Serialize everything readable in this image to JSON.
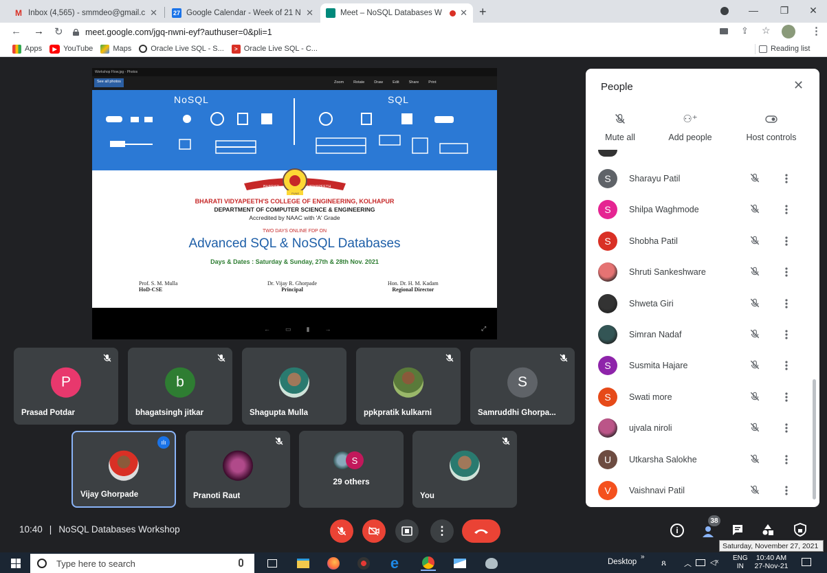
{
  "browser": {
    "tabs": [
      {
        "title": "Inbox (4,565) - smmdeo@gmail.c",
        "favicon": "gmail-icon"
      },
      {
        "title": "Google Calendar - Week of 21 N",
        "favicon": "calendar-icon",
        "favicon_text": "27"
      },
      {
        "title": "Meet – NoSQL Databases W",
        "favicon": "meet-icon",
        "active": true
      }
    ],
    "new_tab": "+",
    "url": "meet.google.com/jgq-nwni-eyf?authuser=0&pli=1",
    "bookmarks": [
      {
        "label": "Apps",
        "icon": "apps-grid-icon"
      },
      {
        "label": "YouTube",
        "icon": "youtube-icon"
      },
      {
        "label": "Maps",
        "icon": "maps-icon"
      },
      {
        "label": "Oracle Live SQL - S...",
        "icon": "oracle-icon"
      },
      {
        "label": "Oracle Live SQL - C...",
        "icon": "oracle-console-icon"
      }
    ],
    "reading_list": "Reading list"
  },
  "presentation": {
    "photos_title": "Workshop Flow.jpg - Photos",
    "see_all": "See all photos",
    "toolbar": [
      "Zoom",
      "Rotate",
      "Draw",
      "Edit",
      "Share",
      "Print"
    ],
    "slide": {
      "nosql": "NoSQL",
      "sql": "SQL",
      "college": "BHARATI VIDYAPEETH'S COLLEGE OF ENGINEERING, KOLHAPUR",
      "logo_left": "BHARATI",
      "logo_right": "VIDYAPEETH",
      "logo_bottom": "PUNE",
      "dept": "DEPARTMENT OF COMPUTER SCIENCE & ENGINEERING",
      "accred": "Accredited by NAAC with 'A' Grade",
      "fdp": "TWO DAYS ONLINE FDP ON",
      "title": "Advanced SQL & NoSQL Databases",
      "dates": "Days & Dates : Saturday & Sunday, 27th & 28th Nov. 2021",
      "people": [
        {
          "name": "Prof. S. M. Mulla",
          "role": "HoD-CSE"
        },
        {
          "name": "Dr. Vijay R. Ghorpade",
          "role": "Principal"
        },
        {
          "name": "Hon. Dr. H. M. Kadam",
          "role": "Regional Director"
        }
      ]
    }
  },
  "tiles": [
    {
      "name": "Prasad Potdar",
      "avatar_letter": "P",
      "color": "#e8386d"
    },
    {
      "name": "bhagatsingh jitkar",
      "avatar_letter": "b",
      "color": "#2e7d32"
    },
    {
      "name": "Shagupta Mulla",
      "avatar_letter": "",
      "color": "#7aa"
    },
    {
      "name": "ppkpratik kulkarni",
      "avatar_letter": "",
      "color": "#8a6"
    },
    {
      "name": "Samruddhi Ghorpa...",
      "avatar_letter": "S",
      "color": "#5f6368"
    },
    {
      "name": "Vijay Ghorpade",
      "avatar_letter": "",
      "color": "#aaa"
    },
    {
      "name": "Pranoti Raut",
      "avatar_letter": "",
      "color": "#603"
    },
    {
      "name": "29 others",
      "avatar_letter": "S",
      "color": "#c2185b"
    },
    {
      "name": "You",
      "avatar_letter": "",
      "color": "#7aa"
    }
  ],
  "people_panel": {
    "title": "People",
    "actions": [
      {
        "label": "Mute all",
        "icon": "mic-off-icon"
      },
      {
        "label": "Add people",
        "icon": "add-person-icon"
      },
      {
        "label": "Host controls",
        "icon": "toggle-icon"
      }
    ],
    "participants": [
      {
        "name": "Sharayu Patil",
        "letter": "S",
        "color": "#5f6368"
      },
      {
        "name": "Shilpa Waghmode",
        "letter": "S",
        "color": "#e52592"
      },
      {
        "name": "Shobha Patil",
        "letter": "S",
        "color": "#d93025"
      },
      {
        "name": "Shruti Sankeshware",
        "letter": "",
        "color": "#e57373"
      },
      {
        "name": "Shweta Giri",
        "letter": "",
        "color": "#333"
      },
      {
        "name": "Simran Nadaf",
        "letter": "",
        "color": "#355"
      },
      {
        "name": "Susmita Hajare",
        "letter": "S",
        "color": "#8e24aa"
      },
      {
        "name": "Swati more",
        "letter": "S",
        "color": "#e64a19"
      },
      {
        "name": "ujvala niroli",
        "letter": "",
        "color": "#b58"
      },
      {
        "name": "Utkarsha Salokhe",
        "letter": "U",
        "color": "#6d4c41"
      },
      {
        "name": "Vaishnavi Patil",
        "letter": "V",
        "color": "#f4511e"
      }
    ]
  },
  "meeting_bar": {
    "time": "10:40",
    "separator": "|",
    "meeting_name": "NoSQL Databases Workshop",
    "participant_count": "38"
  },
  "taskbar": {
    "search_placeholder": "Type here to search",
    "desktop_label": "Desktop",
    "lang": "ENG",
    "region": "IN",
    "time": "10:40 AM",
    "date": "27-Nov-21",
    "tooltip": "Saturday, November 27, 2021"
  },
  "colors": {
    "meet_red": "#ea4335",
    "meet_dark": "#202124",
    "tile_bg": "#3c4043",
    "accent_blue": "#8ab4f8"
  }
}
